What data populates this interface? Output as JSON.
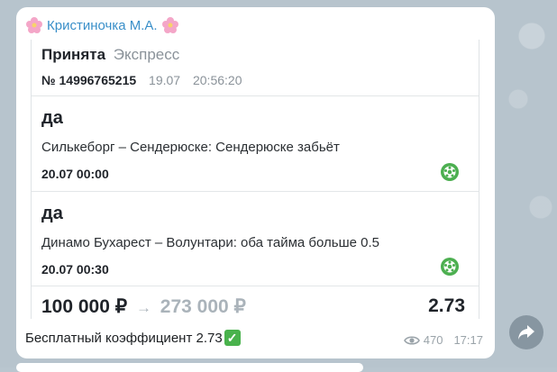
{
  "message": {
    "sender": "Кристиночка М.А.",
    "sender_emoji_left": "flower-icon",
    "sender_emoji_right": "flower-icon",
    "caption": "Бесплатный коэффициент 2.73",
    "caption_emoji": "check-mark-icon",
    "views": "470",
    "time": "17:17"
  },
  "bet": {
    "status": "Принята",
    "type": "Экспресс",
    "number": "№ 14996765215",
    "date": "19.07",
    "time": "20:56:20",
    "events": [
      {
        "pick": "да",
        "match": "Силькеборг – Сендерюске: Сендерюске забьёт",
        "datetime": "20.07 00:00",
        "sport_icon": "football-icon"
      },
      {
        "pick": "да",
        "match": "Динамо Бухарест – Волунтари: оба тайма больше 0.5",
        "datetime": "20.07 00:30",
        "sport_icon": "football-icon"
      }
    ],
    "stake": "100 000 ₽",
    "arrow": "→",
    "payout": "273 000 ₽",
    "coefficient": "2.73"
  },
  "colors": {
    "sender": "#3a8fc9",
    "sport_icon": "#4caf50",
    "muted": "#aab3ba"
  }
}
